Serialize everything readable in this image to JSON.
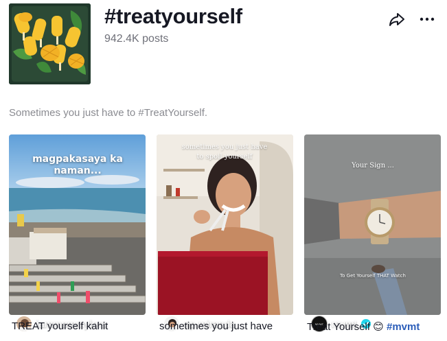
{
  "header": {
    "title": "#treatyourself",
    "post_count": "942.4K posts",
    "description": "Sometimes you just have to #TreatYourself."
  },
  "actions": {
    "share_icon": "share-arrow-icon",
    "more_icon": "more-horizontal-icon"
  },
  "videos": [
    {
      "author": "iammommylors",
      "caption": "TREAT yourself kahit",
      "overlay": "magpakasaya ka naman...",
      "verified": false
    },
    {
      "author": "np.miranda",
      "caption": "sometimes you just have",
      "overlay": "sometimes you just have to spoil yourself",
      "verified": false
    },
    {
      "author": "mvmt",
      "caption_text": "Treat Yourself 😊 ",
      "caption_tag": "#mvmt",
      "overlay_top": "Your Sign ...",
      "overlay_bottom": "To Get Yourself THAT Watch",
      "avatar_text": "MVMT",
      "verified": true
    }
  ],
  "colors": {
    "primary_text": "#161823",
    "secondary_text": "#8a8b91",
    "hashtag": "#2b5db9",
    "verified": "#20d5ec"
  }
}
